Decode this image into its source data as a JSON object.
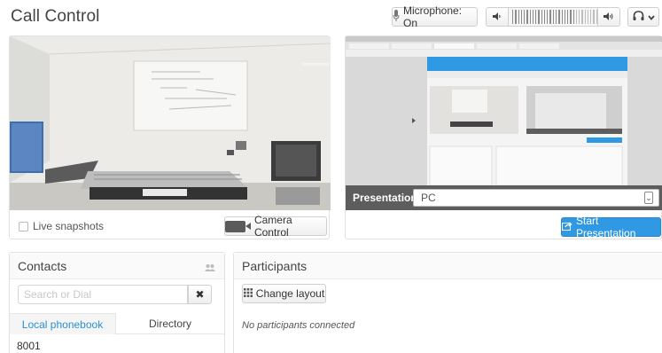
{
  "header": {
    "title": "Call Control",
    "microphone_label": "Microphone: On",
    "volume_down_icon": "speaker-low-icon",
    "volume_up_icon": "speaker-high-icon",
    "volume_level": 0.7,
    "headset_icon": "headset-icon"
  },
  "video": {
    "live_snapshots_label": "Live snapshots",
    "live_snapshots_checked": false,
    "camera_control_label": "Camera Control",
    "camera_icon": "camera-icon"
  },
  "presentation": {
    "label": "Presentation",
    "source_value": "PC",
    "start_label": "Start Presentation",
    "start_icon": "share-icon"
  },
  "contacts": {
    "title": "Contacts",
    "add_icon": "add-contact-icon",
    "search_placeholder": "Search or Dial",
    "clear_label": "✖",
    "tabs": [
      "Local phonebook",
      "Directory"
    ],
    "active_tab": "Local phonebook",
    "entries": [
      "8001"
    ]
  },
  "participants": {
    "title": "Participants",
    "change_layout_label": "Change layout",
    "empty_text": "No participants connected"
  },
  "colors": {
    "accent": "#2f9ae3",
    "tab_active_text": "#2a8fd6",
    "presentation_bar": "#5d5d5d"
  }
}
